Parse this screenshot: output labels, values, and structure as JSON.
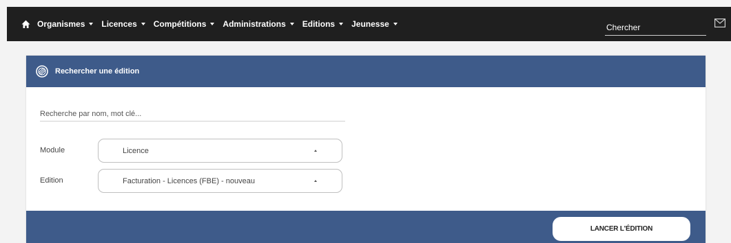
{
  "nav": {
    "items": [
      {
        "label": "Organismes"
      },
      {
        "label": "Licences"
      },
      {
        "label": "Compétitions"
      },
      {
        "label": "Administrations"
      },
      {
        "label": "Editions"
      },
      {
        "label": "Jeunesse"
      }
    ],
    "search_placeholder": "Chercher",
    "help_label": "?"
  },
  "card": {
    "title": "Rechercher une édition",
    "keyword_placeholder": "Recherche par nom, mot clé...",
    "fields": [
      {
        "label": "Module",
        "value": "Licence"
      },
      {
        "label": "Edition",
        "value": "Facturation - Licences (FBE) - nouveau"
      }
    ],
    "submit_label": "LANCER L'ÉDITION"
  },
  "colors": {
    "topbar": "#1f1f1f",
    "accent": "#3e5b8a"
  },
  "icons": [
    "home-icon",
    "mail-icon",
    "compass-icon",
    "chevron-down-icon",
    "chevron-up-icon"
  ]
}
